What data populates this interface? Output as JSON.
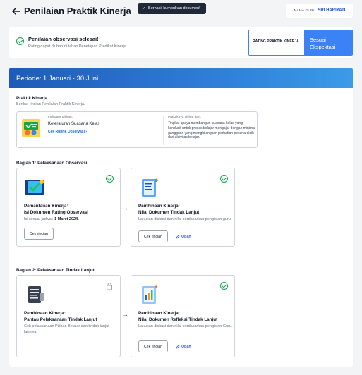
{
  "header": {
    "back_icon": "arrow-left-icon",
    "title": "Penilaian Praktik Kinerja",
    "toast": "Berhasil kumpulkan dokumen!",
    "guru_label": "NAMA GURU",
    "guru_name": "SRI HARIYATI"
  },
  "status": {
    "title": "Penilaian observasi selesai!",
    "subtitle": "Rating dapat diubah di tahap Penetapan Predikat Kinerja.",
    "rating_label": "RATING PRAKTIK KINERJA",
    "rating_value": "Sesuai Ekspektasi",
    "colors": {
      "accent": "#3b82f6",
      "success": "#16a34a"
    }
  },
  "periode": {
    "label": "Periode: 1 Januari - 30 Juni"
  },
  "praktik": {
    "title": "Praktik Kinerja",
    "subtitle": "Berikut rincian Penilaian Praktik Kinerja.",
    "indicator_label": "Indikator pilihan:",
    "indicator_name": "Keteraturan Suasana Kelas",
    "indicator_link": "Cek Rubrik Observasi",
    "practice_label": "Praktiknya dilihat dari:",
    "practice_text": "Tingkat upaya membangun suasana kelas yang kondusif untuk proses belajar mengajar dengan minimal gangguan yang menghilangkan perhatian peserta didik dari aktivitas belajar."
  },
  "bagian1": {
    "title": "Bagian 1: Pelaksanaan Observasi",
    "card1": {
      "title_line1": "Pemantauan Kinerja:",
      "title_line2": "Isi Dokumen Rating Observasi",
      "desc": "Isi sesuai jadwal:",
      "desc_date": "1 Maret 2024.",
      "button": "Cek rincian",
      "status_icon": "check-circle-icon"
    },
    "card2": {
      "title_line1": "Pembinaan Kinerja:",
      "title_line2": "Nilai Dokumen Tindak Lanjut",
      "desc": "Lakukan diskusi dan nilai berdasarkan pengisian guru.",
      "button": "Cek rincian",
      "edit": "Ubah",
      "status_icon": "check-circle-icon"
    }
  },
  "bagian2": {
    "title": "Bagian 2: Pelaksanaan Tindak Lanjut",
    "card1": {
      "title_line1": "Pembinaan Kinerja:",
      "title_line2": "Pantau Pelaksanaan Tindak Lanjut",
      "desc": "Cek pelaksanaan Pilihan Belajar dan tindak lanjut lainnya.",
      "status_icon": "lock-icon"
    },
    "card2": {
      "title_line1": "Pembinaan Kinerja:",
      "title_line2": "Nilai Dokumen Refleksi Tindak Lanjut",
      "desc": "Lakukan diskusi dan nilai berdasarkan pengisian Guru.",
      "button": "Cek rincian",
      "edit": "Ubah",
      "status_icon": "check-circle-icon"
    }
  }
}
